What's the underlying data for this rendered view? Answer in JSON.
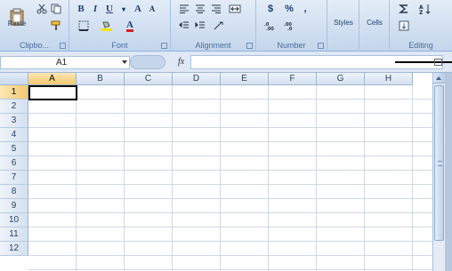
{
  "ribbon": {
    "clipboard": {
      "paste_label": "Paste",
      "group_label": "Clipbo..."
    },
    "font": {
      "bold": "B",
      "italic": "I",
      "underline": "U",
      "grow": "A",
      "shrink": "A",
      "font_color_letter": "A",
      "group_label": "Font"
    },
    "alignment": {
      "group_label": "Alignment"
    },
    "number": {
      "currency": "$",
      "percent": "%",
      "comma": ",",
      "group_label": "Number"
    },
    "styles": {
      "label": "Styles"
    },
    "cells": {
      "label": "Cells"
    },
    "editing": {
      "group_label": "Editing"
    }
  },
  "formula_bar": {
    "name_box": "A1",
    "fx_label": "fx",
    "formula": ""
  },
  "sheet": {
    "columns": [
      "A",
      "B",
      "C",
      "D",
      "E",
      "F",
      "G",
      "H"
    ],
    "rows": [
      "1",
      "2",
      "3",
      "4",
      "5",
      "6",
      "7",
      "8",
      "9",
      "10",
      "11",
      "12"
    ],
    "active_cell": "A1"
  },
  "colors": {
    "ribbon_bg": "#dce7f5",
    "active_header": "#f4c870",
    "grid_line": "#d0d7e5"
  }
}
